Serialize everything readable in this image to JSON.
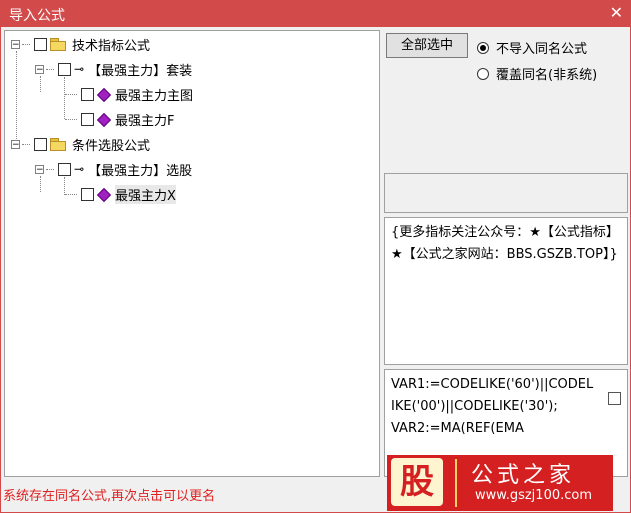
{
  "window": {
    "title": "导入公式",
    "close_glyph": "✕"
  },
  "tree": {
    "nodes": [
      {
        "label": "技术指标公式",
        "type": "folder"
      },
      {
        "label": "【最强主力】套装",
        "type": "group"
      },
      {
        "label": "最强主力主图",
        "type": "formula"
      },
      {
        "label": "最强主力F",
        "type": "formula"
      },
      {
        "label": "条件选股公式",
        "type": "folder"
      },
      {
        "label": "【最强主力】选股",
        "type": "group"
      },
      {
        "label": "最强主力X",
        "type": "formula"
      }
    ],
    "expanded_glyph": "−"
  },
  "options": {
    "select_all_label": "全部选中",
    "radio_skip_label": "不导入同名公式",
    "radio_overwrite_label": "覆盖同名(非系统)",
    "selected": "skip"
  },
  "description": "{更多指标关注公众号：★【公式指标】★【公式之家网站：BBS.GSZB.TOP】}",
  "code": "VAR1:=CODELIKE('60')||CODELIKE('00')||CODELIKE('30');\nVAR2:=MA(REF(EMA",
  "status": "系统存在同名公式,再次点击可以更名",
  "logo": {
    "big_char": "股",
    "name": "公式之家",
    "url": "www.gszj100.com"
  },
  "colors": {
    "title_bar": "#d24a4a",
    "status_text": "#e02020",
    "logo_bg": "#d42020"
  }
}
